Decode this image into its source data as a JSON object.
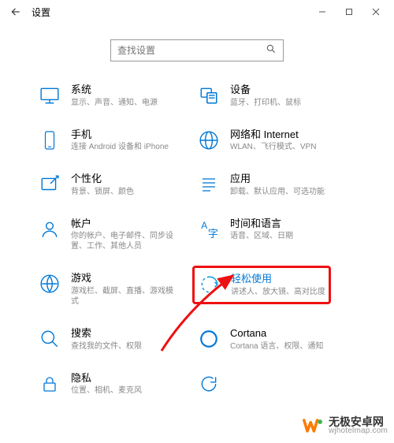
{
  "window": {
    "title": "设置"
  },
  "search": {
    "placeholder": "查找设置"
  },
  "items": {
    "system": {
      "title": "系统",
      "desc": "显示、声音、通知、电源"
    },
    "devices": {
      "title": "设备",
      "desc": "蓝牙、打印机、鼠标"
    },
    "phone": {
      "title": "手机",
      "desc": "连接 Android 设备和 iPhone"
    },
    "network": {
      "title": "网络和 Internet",
      "desc": "WLAN、飞行模式、VPN"
    },
    "personal": {
      "title": "个性化",
      "desc": "背景、锁屏、颜色"
    },
    "apps": {
      "title": "应用",
      "desc": "卸载、默认应用、可选功能"
    },
    "accounts": {
      "title": "帐户",
      "desc": "你的帐户、电子邮件、同步设置、工作、其他人员"
    },
    "time": {
      "title": "时间和语言",
      "desc": "语音、区域、日期"
    },
    "gaming": {
      "title": "游戏",
      "desc": "游戏栏、截屏、直播、游戏模式"
    },
    "ease": {
      "title": "轻松使用",
      "desc": "讲述人、放大镜、高对比度"
    },
    "searchcat": {
      "title": "搜索",
      "desc": "查找我的文件、权限"
    },
    "cortana": {
      "title": "Cortana",
      "desc": "Cortana 语言、权限、通知"
    },
    "privacy": {
      "title": "隐私",
      "desc": "位置、相机、麦克风"
    }
  },
  "watermark": {
    "line1": "无极安卓网",
    "line2": "wjhotelmap.com"
  }
}
